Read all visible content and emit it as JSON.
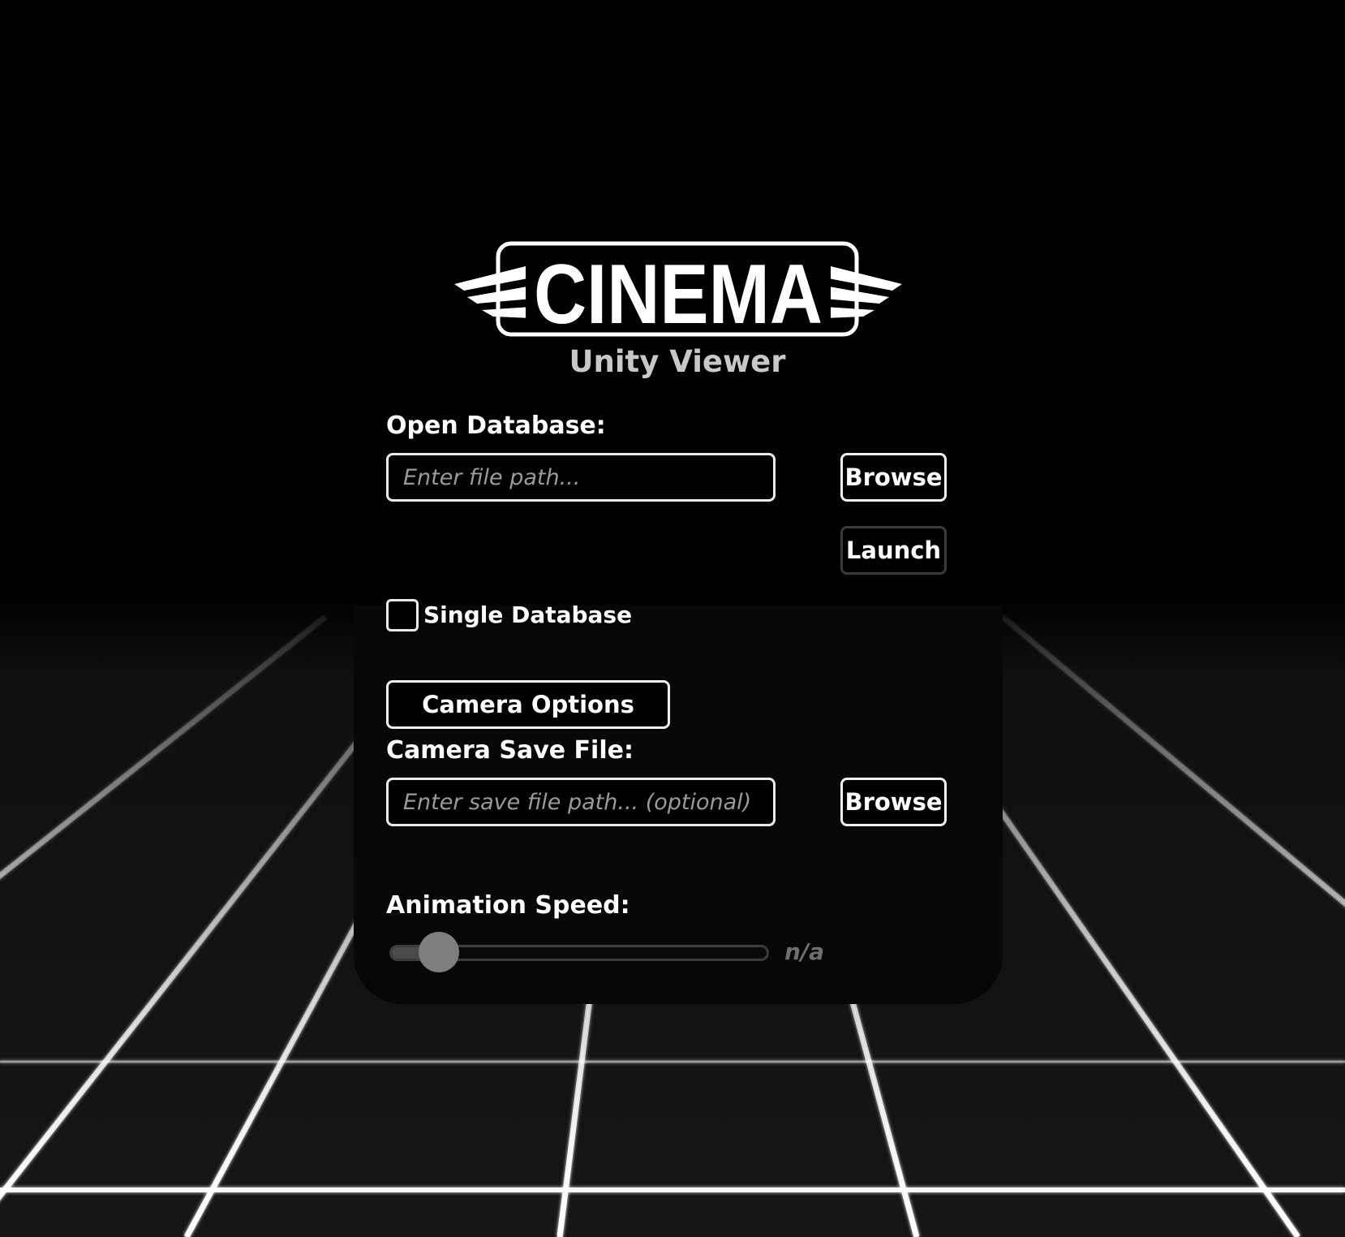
{
  "app": {
    "logo_text": "CINEMA",
    "subtitle": "Unity Viewer"
  },
  "open_database": {
    "label": "Open Database:",
    "placeholder": "Enter file path...",
    "value": "",
    "browse_label": "Browse",
    "launch_label": "Launch"
  },
  "single_database": {
    "label": "Single Database",
    "checked": false
  },
  "camera": {
    "options_label": "Camera Options",
    "save_file_label": "Camera Save File:",
    "save_placeholder": "Enter save file path... (optional)",
    "save_value": "",
    "browse_label": "Browse"
  },
  "animation": {
    "label": "Animation Speed:",
    "value_text": "n/a",
    "slider_level": 0.13
  },
  "colors": {
    "background": "#000000",
    "panel": "#070707",
    "text": "#ffffff",
    "subtitle": "#c8c8c8",
    "placeholder": "#9a9a9a",
    "grid_line": "#ffffff"
  },
  "icons": {
    "logo": "cinema-winged-logo",
    "thumb": "slider-thumb"
  }
}
